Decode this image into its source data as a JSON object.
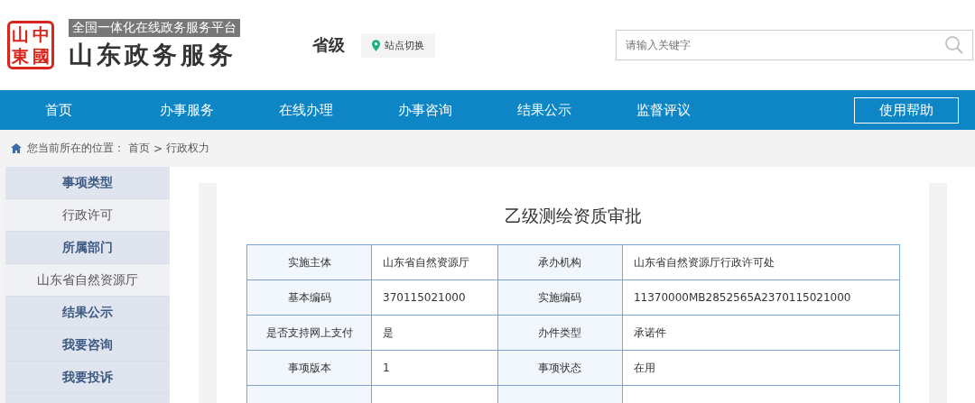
{
  "header": {
    "seal": [
      "山",
      "東",
      "中",
      "國"
    ],
    "tagline": "全国一体化在线政务服务平台",
    "site_name": "山东政务服务",
    "level": "省级",
    "switch_button": "站点切换",
    "search": {
      "placeholder": "请输入关键字"
    }
  },
  "nav": {
    "items": [
      {
        "label": "首页",
        "selected": false
      },
      {
        "label": "办事服务",
        "selected": false
      },
      {
        "label": "在线办理",
        "selected": false
      },
      {
        "label": "办事咨询",
        "selected": false
      },
      {
        "label": "结果公示",
        "selected": false
      },
      {
        "label": "监督评议",
        "selected": false
      }
    ],
    "help_button": "使用帮助"
  },
  "breadcrumb": {
    "prefix": "您当前所在的位置：",
    "items": [
      "首页",
      "行政权力"
    ],
    "separator": ">"
  },
  "sidebar": {
    "items": [
      {
        "kind": "heading",
        "label": "事项类型"
      },
      {
        "kind": "value",
        "label": "行政许可"
      },
      {
        "kind": "heading",
        "label": "所属部门"
      },
      {
        "kind": "value",
        "label": "山东省自然资源厅"
      },
      {
        "kind": "heading",
        "label": "结果公示"
      },
      {
        "kind": "heading",
        "label": "我要咨询"
      },
      {
        "kind": "heading",
        "label": "我要投诉"
      }
    ]
  },
  "detail": {
    "title": "乙级测绘资质审批",
    "rows": [
      {
        "label_1": "实施主体",
        "value_1": "山东省自然资源厅",
        "label_2": "承办机构",
        "value_2": "山东省自然资源厅行政许可处"
      },
      {
        "label_1": "基本编码",
        "value_1": "370115021000",
        "label_2": "实施编码",
        "value_2": "11370000MB2852565A2370115021000"
      },
      {
        "label_1": "是否支持网上支付",
        "value_1": "是",
        "label_2": "办件类型",
        "value_2": "承诺件"
      },
      {
        "label_1": "事项版本",
        "value_1": "1",
        "label_2": "事项状态",
        "value_2": "在用"
      }
    ]
  }
}
